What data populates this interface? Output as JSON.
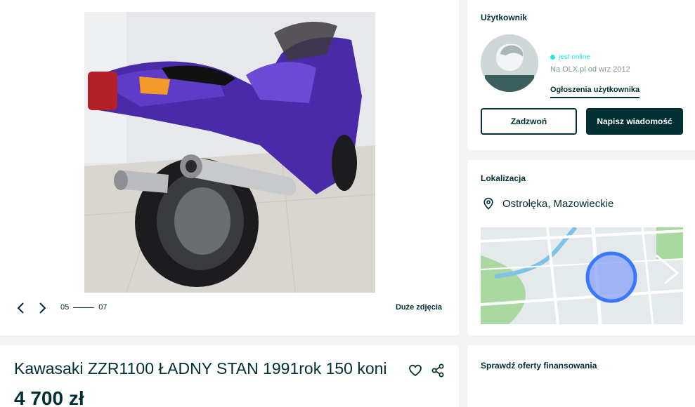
{
  "gallery": {
    "current_index": "05",
    "total": "07",
    "big_photos_label": "Duże zdjęcia",
    "photo_subject": "purple Kawasaki ZZR1100 motorcycle, rear three-quarter view"
  },
  "user": {
    "section_title": "Użytkownik",
    "online_status": "jest online",
    "member_since": "Na OLX.pl od wrz 2012",
    "ads_link_label": "Ogłoszenia użytkownika",
    "call_button_label": "Zadzwoń",
    "message_button_label": "Napisz wiadomość"
  },
  "location": {
    "section_title": "Lokalizacja",
    "place": "Ostrołęka, Mazowieckie"
  },
  "listing": {
    "title": "Kawasaki ZZR1100 ŁADNY STAN 1991rok 150 koni",
    "price": "4 700 zł"
  },
  "finance": {
    "section_title": "Sprawdź oferty finansowania"
  },
  "icons": {
    "prev": "chevron-left-icon",
    "next": "chevron-right-icon",
    "location": "location-pin-icon",
    "favorite": "heart-icon",
    "share": "share-icon"
  },
  "colors": {
    "brand_dark": "#002f34",
    "online": "#23e5db",
    "map_highlight": "#3a77ff",
    "page_background": "#f2f4f5"
  }
}
